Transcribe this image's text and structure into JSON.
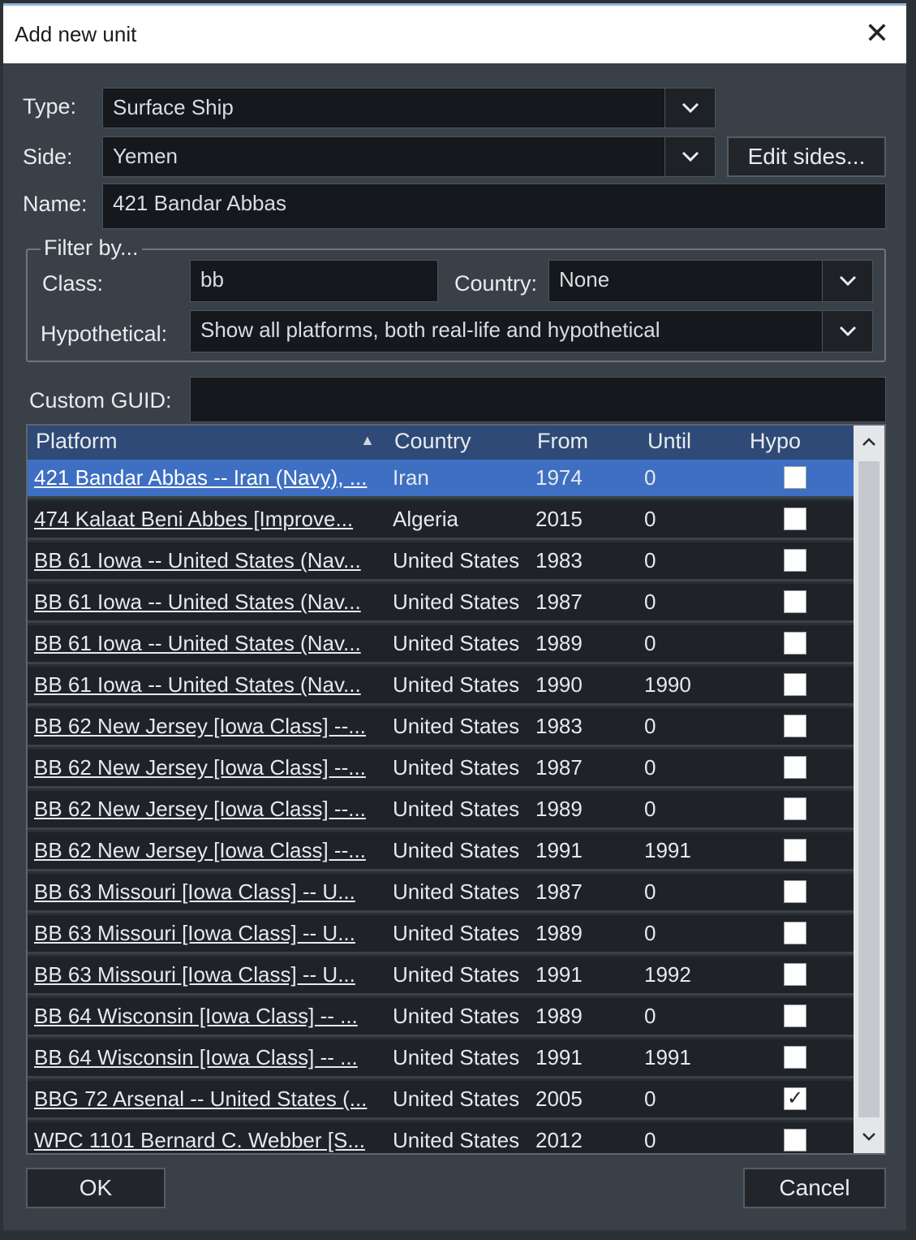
{
  "dialog": {
    "title": "Add new unit",
    "close_glyph": "✕"
  },
  "form": {
    "type_label": "Type:",
    "type_value": "Surface Ship",
    "side_label": "Side:",
    "side_value": "Yemen",
    "edit_sides_label": "Edit sides...",
    "name_label": "Name:",
    "name_value": "421 Bandar Abbas",
    "filter_legend": "Filter by...",
    "class_label": "Class:",
    "class_value": "bb",
    "country_label": "Country:",
    "country_value": "None",
    "hypothetical_label": "Hypothetical:",
    "hypothetical_value": "Show all platforms, both real-life and hypothetical",
    "guid_label": "Custom GUID:",
    "guid_value": ""
  },
  "grid": {
    "columns": [
      "Platform",
      "Country",
      "From",
      "Until",
      "Hypo"
    ],
    "sort_glyph": "▲",
    "rows": [
      {
        "platform": "421 Bandar Abbas -- Iran (Navy), ...",
        "country": "Iran",
        "from": "1974",
        "until": "0",
        "hypo": false,
        "selected": true
      },
      {
        "platform": "474 Kalaat Beni Abbes [Improve...",
        "country": "Algeria",
        "from": "2015",
        "until": "0",
        "hypo": false
      },
      {
        "platform": "BB 61 Iowa -- United States (Nav...",
        "country": "United States",
        "from": "1983",
        "until": "0",
        "hypo": false
      },
      {
        "platform": "BB 61 Iowa -- United States (Nav...",
        "country": "United States",
        "from": "1987",
        "until": "0",
        "hypo": false
      },
      {
        "platform": "BB 61 Iowa -- United States (Nav...",
        "country": "United States",
        "from": "1989",
        "until": "0",
        "hypo": false
      },
      {
        "platform": "BB 61 Iowa -- United States (Nav...",
        "country": "United States",
        "from": "1990",
        "until": "1990",
        "hypo": false
      },
      {
        "platform": "BB 62 New Jersey [Iowa Class] --...",
        "country": "United States",
        "from": "1983",
        "until": "0",
        "hypo": false
      },
      {
        "platform": "BB 62 New Jersey [Iowa Class] --...",
        "country": "United States",
        "from": "1987",
        "until": "0",
        "hypo": false
      },
      {
        "platform": "BB 62 New Jersey [Iowa Class] --...",
        "country": "United States",
        "from": "1989",
        "until": "0",
        "hypo": false
      },
      {
        "platform": "BB 62 New Jersey [Iowa Class] --...",
        "country": "United States",
        "from": "1991",
        "until": "1991",
        "hypo": false
      },
      {
        "platform": "BB 63 Missouri [Iowa Class] -- U...",
        "country": "United States",
        "from": "1987",
        "until": "0",
        "hypo": false
      },
      {
        "platform": "BB 63 Missouri [Iowa Class] -- U...",
        "country": "United States",
        "from": "1989",
        "until": "0",
        "hypo": false
      },
      {
        "platform": "BB 63 Missouri [Iowa Class] -- U...",
        "country": "United States",
        "from": "1991",
        "until": "1992",
        "hypo": false
      },
      {
        "platform": "BB 64 Wisconsin [Iowa Class] -- ...",
        "country": "United States",
        "from": "1989",
        "until": "0",
        "hypo": false
      },
      {
        "platform": "BB 64 Wisconsin [Iowa Class] -- ...",
        "country": "United States",
        "from": "1991",
        "until": "1991",
        "hypo": false
      },
      {
        "platform": "BBG 72 Arsenal -- United States (...",
        "country": "United States",
        "from": "2005",
        "until": "0",
        "hypo": true
      },
      {
        "platform": "WPC 1101 Bernard C. Webber [S...",
        "country": "United States",
        "from": "2012",
        "until": "0",
        "hypo": false
      }
    ]
  },
  "footer": {
    "ok_label": "OK",
    "cancel_label": "Cancel"
  },
  "icons": {
    "dropdown": "chevron-down-icon",
    "check": "✓",
    "scroll_up": "⌃",
    "scroll_down": "⌄"
  }
}
